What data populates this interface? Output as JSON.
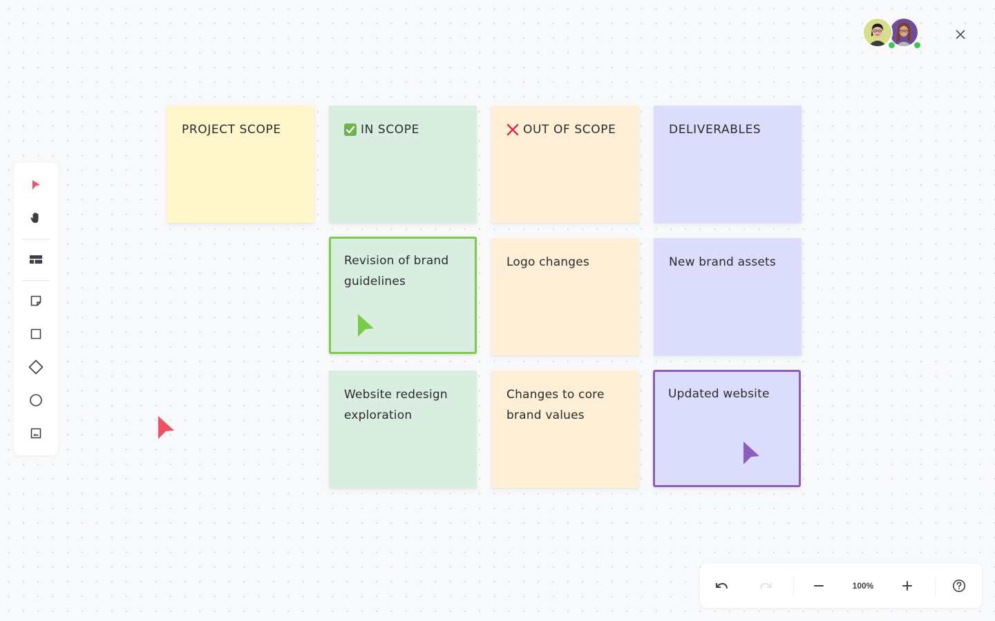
{
  "header": {
    "collaborators": [
      {
        "name": "collaborator-1",
        "bg": "#d6e08a",
        "online": true
      },
      {
        "name": "collaborator-2",
        "bg": "#6f4c9a",
        "online": true
      }
    ],
    "close_icon": "close-icon"
  },
  "toolbar": {
    "tools": [
      {
        "id": "select",
        "icon": "cursor-arrow-icon",
        "active": true,
        "color": "#f0505f"
      },
      {
        "id": "hand",
        "icon": "hand-pan-icon"
      },
      {
        "id": "template",
        "icon": "template-layout-icon"
      },
      {
        "id": "sticky-note",
        "icon": "sticky-note-icon"
      },
      {
        "id": "rectangle",
        "icon": "square-icon"
      },
      {
        "id": "diamond",
        "icon": "diamond-icon"
      },
      {
        "id": "circle",
        "icon": "circle-icon"
      },
      {
        "id": "image",
        "icon": "image-icon"
      }
    ]
  },
  "board": {
    "columns": [
      {
        "header": "PROJECT SCOPE",
        "icon": null,
        "color": "yellow",
        "items": []
      },
      {
        "header": "IN SCOPE",
        "icon": "checkbox-checked-icon",
        "color": "green",
        "items": [
          "Revision of brand guidelines",
          "Website redesign exploration"
        ]
      },
      {
        "header": "OUT OF SCOPE",
        "icon": "cross-mark-icon",
        "color": "orange",
        "items": [
          "Logo changes",
          "Changes to core brand values"
        ]
      },
      {
        "header": "DELIVERABLES",
        "icon": null,
        "color": "purple",
        "items": [
          "New brand assets",
          "Updated website"
        ]
      }
    ],
    "colors": {
      "yellow": "#fff6cc",
      "green": "#d9eee0",
      "orange": "#ffefd6",
      "purple": "#dcdcfc",
      "selection_green": "#79cc48",
      "selection_purple": "#8a5dbf",
      "cursor_red": "#f0505f"
    }
  },
  "bottom_bar": {
    "undo_icon": "undo-icon",
    "redo_icon": "redo-icon",
    "redo_disabled": true,
    "zoom_out_icon": "minus-icon",
    "zoom_level": "100%",
    "zoom_in_icon": "plus-icon",
    "help_icon": "help-icon"
  }
}
